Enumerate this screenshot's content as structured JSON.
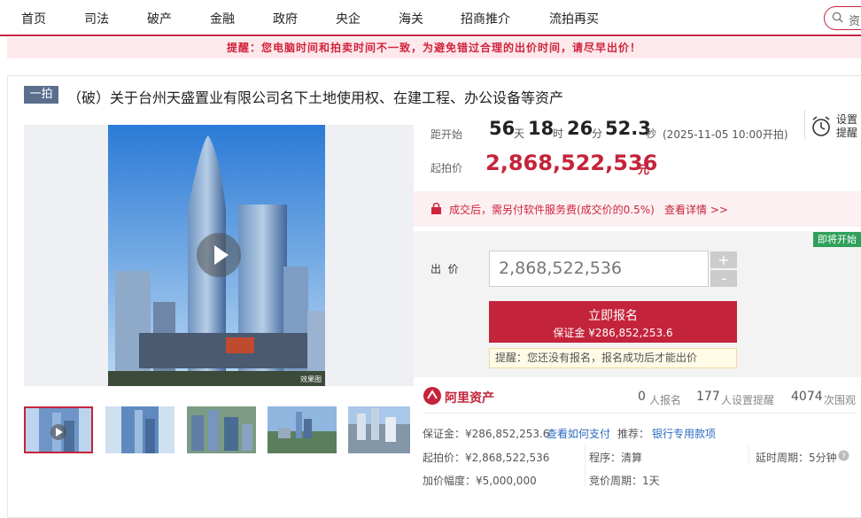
{
  "nav": {
    "items": [
      "首页",
      "司法",
      "破产",
      "金融",
      "政府",
      "央企",
      "海关",
      "招商推介",
      "流拍再买"
    ],
    "search_text": "资"
  },
  "notice": "提醒：您电脑时间和拍卖时间不一致，为避免错过合理的出价时间，请尽早出价！",
  "auction": {
    "badge": "一拍",
    "title": "（破）关于台州天盛置业有限公司名下土地使用权、在建工程、办公设备等资产",
    "countdown_label": "距开始",
    "days": "56",
    "days_unit": "天",
    "hours": "18",
    "hours_unit": "时",
    "minutes": "26",
    "minutes_unit": "分",
    "seconds": "52.3",
    "seconds_unit": "秒",
    "start_time": "(2025-11-05 10:00开拍)",
    "remind_label_1": "设置",
    "remind_label_2": "提醒",
    "start_price_label": "起拍价",
    "start_price": "2,868,522,536",
    "start_price_unit": "元",
    "fee_text": "成交后，需另付软件服务费(成交价的0.5%)",
    "fee_link": "查看详情 >>",
    "status_badge": "即将开始",
    "bid_label": "出  价",
    "bid_value": "2,868,522,536",
    "plus": "+",
    "minus": "-",
    "signup_label": "立即报名",
    "signup_deposit": "保证金 ¥286,852,253.6",
    "tip": "提醒：您还没有报名，报名成功后才能出价",
    "watermark": "效果图"
  },
  "platform": {
    "name": "阿里资产",
    "signups_count": "0",
    "signups_label": "人报名",
    "reminders_count": "177",
    "reminders_label": "人设置提醒",
    "views_count": "4074",
    "views_label": "次围观"
  },
  "details": {
    "deposit": "保证金：¥286,852,253.6",
    "how_to_pay": "查看如何支付",
    "recommend_label": "推荐：",
    "recommend_link": "银行专用款项",
    "start_price": "起拍价：¥2,868,522,536",
    "procedure": "程序：清算",
    "delay": "延时周期：5分钟",
    "increment": "加价幅度：¥5,000,000",
    "bid_period": "竞价周期：1天"
  },
  "colors": {
    "brand": "#c4243b",
    "badge": "#5b6e8c",
    "green": "#2ea05a",
    "link": "#2d6bbf"
  }
}
